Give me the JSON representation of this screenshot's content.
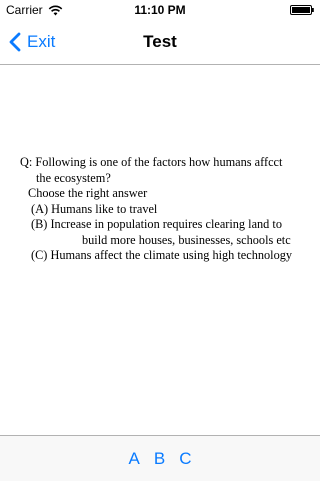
{
  "status_bar": {
    "carrier": "Carrier",
    "time": "11:10 PM"
  },
  "nav": {
    "back_label": "Exit",
    "title": "Test"
  },
  "question": {
    "line1": "Q: Following is one of  the  factors how humans affcct",
    "line2": "the   ecosystem?",
    "prompt": "Choose the right answer",
    "option_a": "(A) Humans like to travel",
    "option_b_line1": "(B) Increase in population requires clearing land to",
    "option_b_line2": "build more houses, businesses, schools etc",
    "option_c": "(C) Humans affect the climate using high technology"
  },
  "answers": [
    "A",
    "B",
    "C"
  ],
  "colors": {
    "accent": "#0a7bff",
    "divider": "#b2b2b2"
  }
}
